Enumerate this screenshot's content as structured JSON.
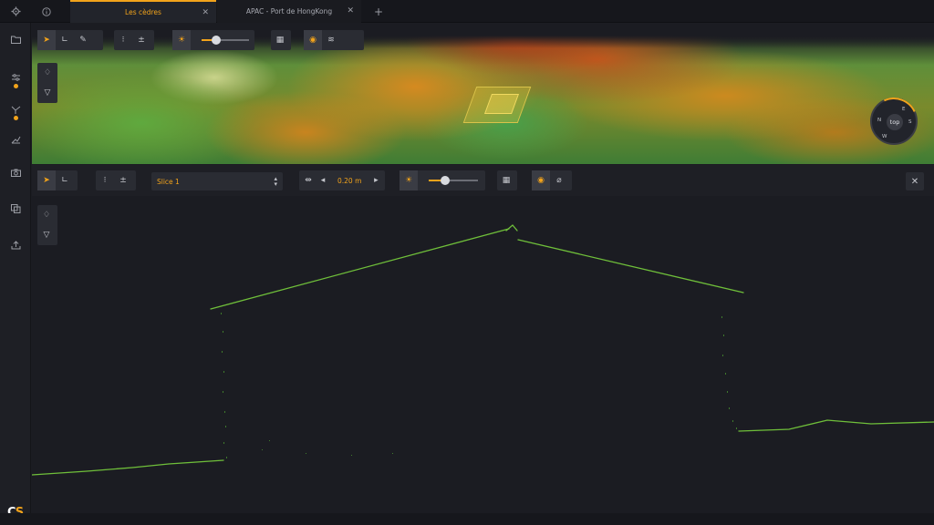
{
  "tabs": [
    {
      "label": "Les cèdres",
      "active": true
    },
    {
      "label": "APAC - Port de HongKong",
      "active": false
    }
  ],
  "topbar": {
    "settings_icon": "gear-icon",
    "info_icon": "info-icon",
    "add_tab_icon": "plus-icon"
  },
  "sidebar": {
    "items": [
      "folder-icon",
      "layers-settings-icon",
      "classification-icon",
      "measure-icon",
      "camera-icon",
      "clip-icon",
      "export-icon"
    ],
    "logo": {
      "main": "C",
      "accent": "S"
    }
  },
  "view3d": {
    "compass": {
      "label": "top",
      "n": "N",
      "e": "E",
      "s": "S",
      "w": "W"
    },
    "brightness_level": 0.3
  },
  "slice": {
    "select_value": "Slice 1",
    "thickness": "0.20 m",
    "brightness_level": 0.35
  },
  "colors": {
    "accent": "#f2a31b",
    "background": "#1b1c22",
    "profile": "#6fbf3a"
  }
}
